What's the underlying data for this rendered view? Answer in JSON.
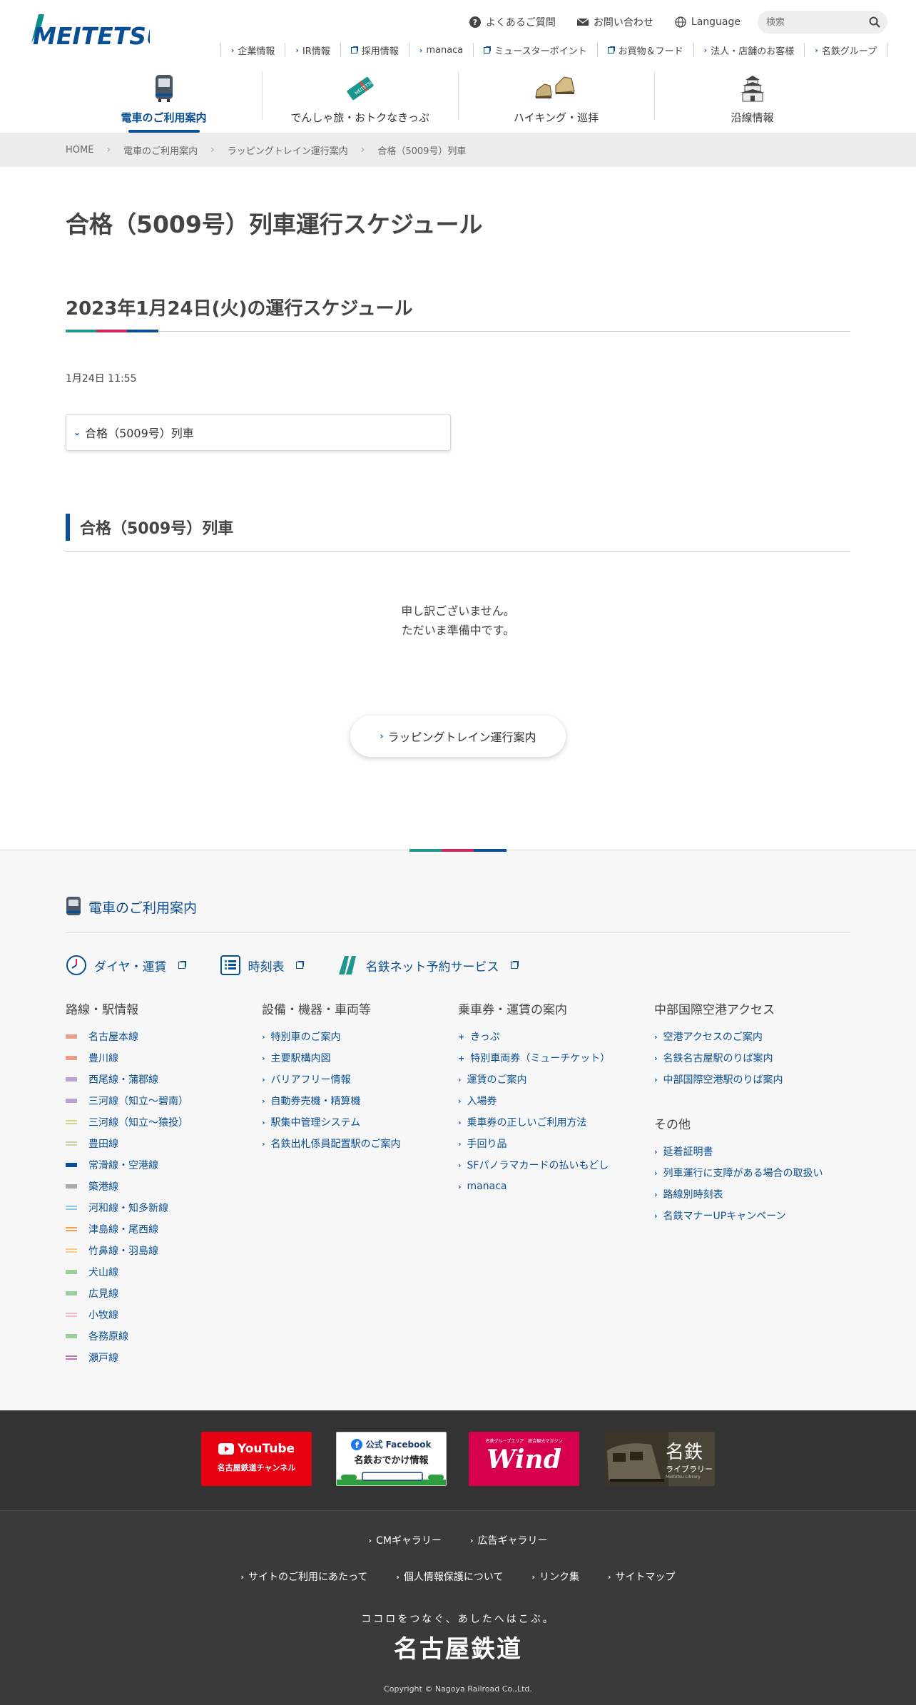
{
  "brand": {
    "logo_text": "MEITETSU",
    "color": "#0a4f93"
  },
  "util": {
    "faq": "よくあるご質問",
    "contact": "お問い合わせ",
    "language": "Language",
    "search_placeholder": "検索"
  },
  "sublinks": [
    {
      "label": "企業情報",
      "type": "arrow"
    },
    {
      "label": "IR情報",
      "type": "arrow"
    },
    {
      "label": "採用情報",
      "type": "ext"
    },
    {
      "label": "manaca",
      "type": "arrow"
    },
    {
      "label": "ミュースターポイント",
      "type": "ext"
    },
    {
      "label": "お買物＆フード",
      "type": "ext"
    },
    {
      "label": "法人・店舗のお客様",
      "type": "arrow"
    },
    {
      "label": "名鉄グループ",
      "type": "arrow"
    }
  ],
  "gnav": [
    {
      "label": "電車のご利用案内",
      "icon": "train-icon",
      "active": true
    },
    {
      "label": "でんしゃ旅・おトクなきっぷ",
      "icon": "ticket-icon",
      "active": false
    },
    {
      "label": "ハイキング・巡拝",
      "icon": "hiking-boots-icon",
      "active": false
    },
    {
      "label": "沿線情報",
      "icon": "castle-icon",
      "active": false
    }
  ],
  "breadcrumb": [
    "HOME",
    "電車のご利用案内",
    "ラッピングトレイン運行案内",
    "合格（5009号）列車"
  ],
  "main": {
    "page_title": "合格（5009号）列車運行スケジュール",
    "schedule_title": "2023年1月24日(火)の運行スケジュール",
    "updated": "1月24日 11:55",
    "select_label": "合格（5009号）列車",
    "section_title": "合格（5009号）列車",
    "sorry_line1": "申し訳ございません。",
    "sorry_line2": "ただいま準備中です。",
    "back_button": "ラッピングトレイン運行案内"
  },
  "footer_nav": {
    "heading": "電車のご利用案内",
    "quick": [
      "ダイヤ・運賃",
      "時刻表",
      "名鉄ネット予約サービス"
    ],
    "col1_title": "路線・駅情報",
    "lines": [
      {
        "label": "名古屋本線",
        "color": "#e8a08a",
        "double": false
      },
      {
        "label": "豊川線",
        "color": "#e8a08a",
        "double": false
      },
      {
        "label": "西尾線・蒲郡線",
        "color": "#b9a3d6",
        "double": false
      },
      {
        "label": "三河線（知立〜碧南）",
        "color": "#b9a3d6",
        "double": false
      },
      {
        "label": "三河線（知立〜猿投）",
        "color": "#d6d28a",
        "double": true
      },
      {
        "label": "豊田線",
        "color": "#c9d39a",
        "double": true
      },
      {
        "label": "常滑線・空港線",
        "color": "#0a4f93",
        "double": false
      },
      {
        "label": "築港線",
        "color": "#aaaaaa",
        "double": false
      },
      {
        "label": "河和線・知多新線",
        "color": "#8cc8e8",
        "double": true
      },
      {
        "label": "津島線・尾西線",
        "color": "#f0a050",
        "double": true
      },
      {
        "label": "竹鼻線・羽島線",
        "color": "#f0d080",
        "double": true
      },
      {
        "label": "犬山線",
        "color": "#9ccf9c",
        "double": false
      },
      {
        "label": "広見線",
        "color": "#9ccf9c",
        "double": false
      },
      {
        "label": "小牧線",
        "color": "#f4b8c8",
        "double": true
      },
      {
        "label": "各務原線",
        "color": "#9ccf9c",
        "double": false
      },
      {
        "label": "瀬戸線",
        "color": "#b878b8",
        "double": true
      }
    ],
    "col2_title": "設備・機器・車両等",
    "col2": [
      "特別車のご案内",
      "主要駅構内図",
      "バリアフリー情報",
      "自動券売機・精算機",
      "駅集中管理システム",
      "名鉄出札係員配置駅のご案内"
    ],
    "col3_title": "乗車券・運賃の案内",
    "col3": [
      {
        "label": "きっぷ",
        "mark": "+"
      },
      {
        "label": "特別車両券（ミューチケット）",
        "mark": "+"
      },
      {
        "label": "運賃のご案内",
        "mark": "›"
      },
      {
        "label": "入場券",
        "mark": "›"
      },
      {
        "label": "乗車券の正しいご利用方法",
        "mark": "›"
      },
      {
        "label": "手回り品",
        "mark": "›"
      },
      {
        "label": "SFパノラマカードの払いもどし",
        "mark": "›"
      },
      {
        "label": "manaca",
        "mark": "›"
      }
    ],
    "col4_title": "中部国際空港アクセス",
    "col4": [
      "空港アクセスのご案内",
      "名鉄名古屋駅のりば案内",
      "中部国際空港駅のりば案内"
    ],
    "col4b_title": "その他",
    "col4b": [
      "延着証明書",
      "列車運行に支障がある場合の取扱い",
      "路線別時刻表",
      "名鉄マナーUPキャンペーン"
    ]
  },
  "banners": {
    "youtube_top": "YouTube",
    "youtube_sub": "名古屋鉄道チャンネル",
    "fb_top": "公式 Facebook",
    "fb_sub": "名鉄おでかけ情報",
    "wind_small": "名鉄グループエリア　総合観光マガジン",
    "wind_title": "Wind",
    "lib_title": "名鉄",
    "lib_sub": "ライブラリー",
    "lib_en": "Meitetsu Library"
  },
  "bottom": {
    "row1": [
      "CMギャラリー",
      "広告ギャラリー"
    ],
    "row2": [
      "サイトのご利用にあたって",
      "個人情報保護について",
      "リンク集",
      "サイトマップ"
    ],
    "slogan": "ココロをつなぐ、あしたへはこぶ。",
    "corp": "名古屋鉄道",
    "copyright": "Copyright © Nagoya Railroad Co.,Ltd."
  }
}
